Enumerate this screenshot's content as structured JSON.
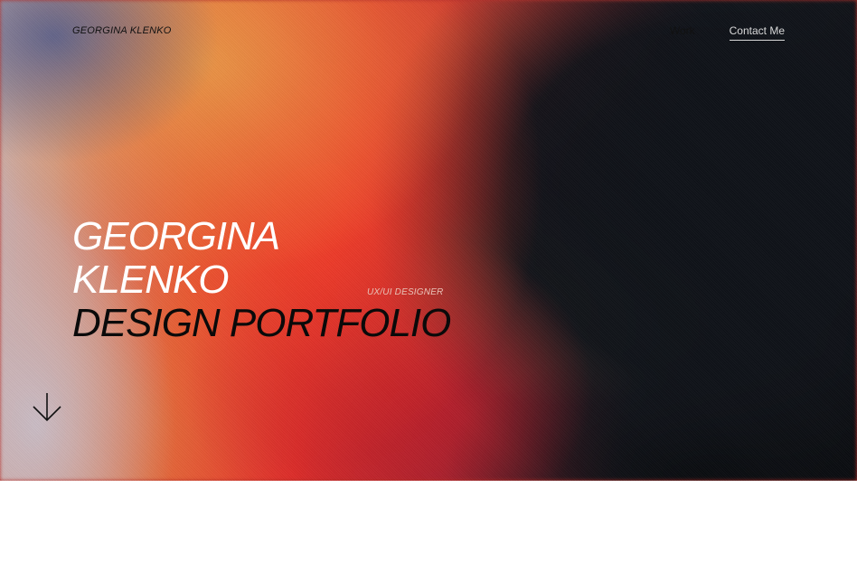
{
  "header": {
    "brand": "GEORGINA KLENKO",
    "nav": {
      "work_label": "Work",
      "contact_label": "Contact Me"
    }
  },
  "hero": {
    "line1": "GEORGINA",
    "line2": "KLENKO",
    "line3": "DESIGN PORTFOLIO",
    "role": "UX/UI DESIGNER",
    "scroll_icon": "arrow-down-icon"
  },
  "colors": {
    "text_dark": "#111111",
    "text_light": "#ffffff",
    "accent_red": "#e8322a",
    "accent_orange": "#e26b3a",
    "dark_bg": "#0b0d12",
    "page_bg": "#ffffff"
  }
}
